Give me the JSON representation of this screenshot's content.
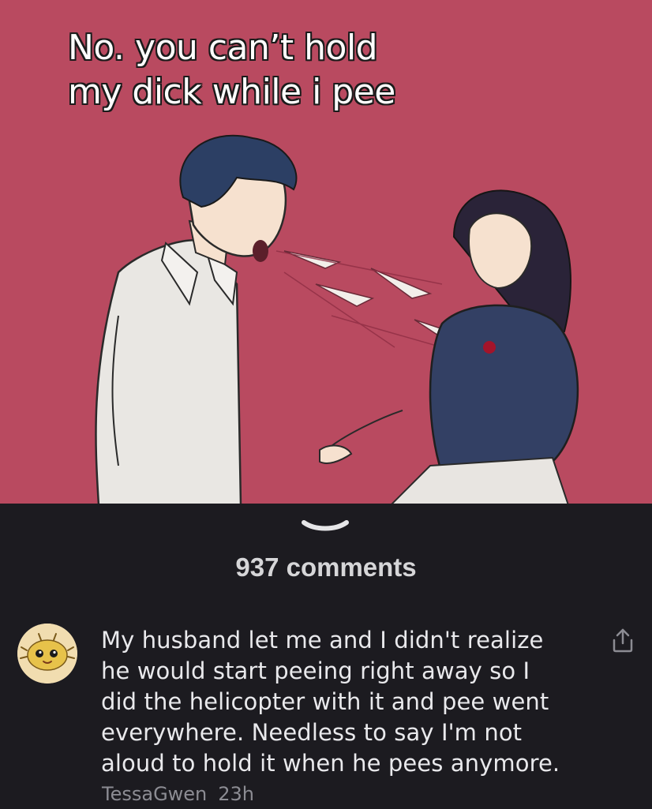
{
  "post": {
    "caption_lines": [
      "No. you can’t hold",
      "my dick while i pee"
    ],
    "background_color": "#b94a60",
    "icons": [
      "collapse-chevron-icon"
    ]
  },
  "comments_header": {
    "count_label": "937 comments"
  },
  "comment": {
    "avatar_icon": "pufferfish-avatar",
    "text_lines": [
      "My husband let me and I didn't realize",
      "he would start peeing right away so I",
      "did the helicopter with it and pee went",
      "everywhere. Needless to say I'm not",
      "aloud to hold it when he pees anymore."
    ],
    "author": "TessaGwen",
    "time": "23h",
    "share_icon": "share-icon"
  },
  "colors": {
    "app_background": "#1c1b20",
    "text_primary": "#e9e9ec",
    "text_secondary": "#8c8c93"
  }
}
